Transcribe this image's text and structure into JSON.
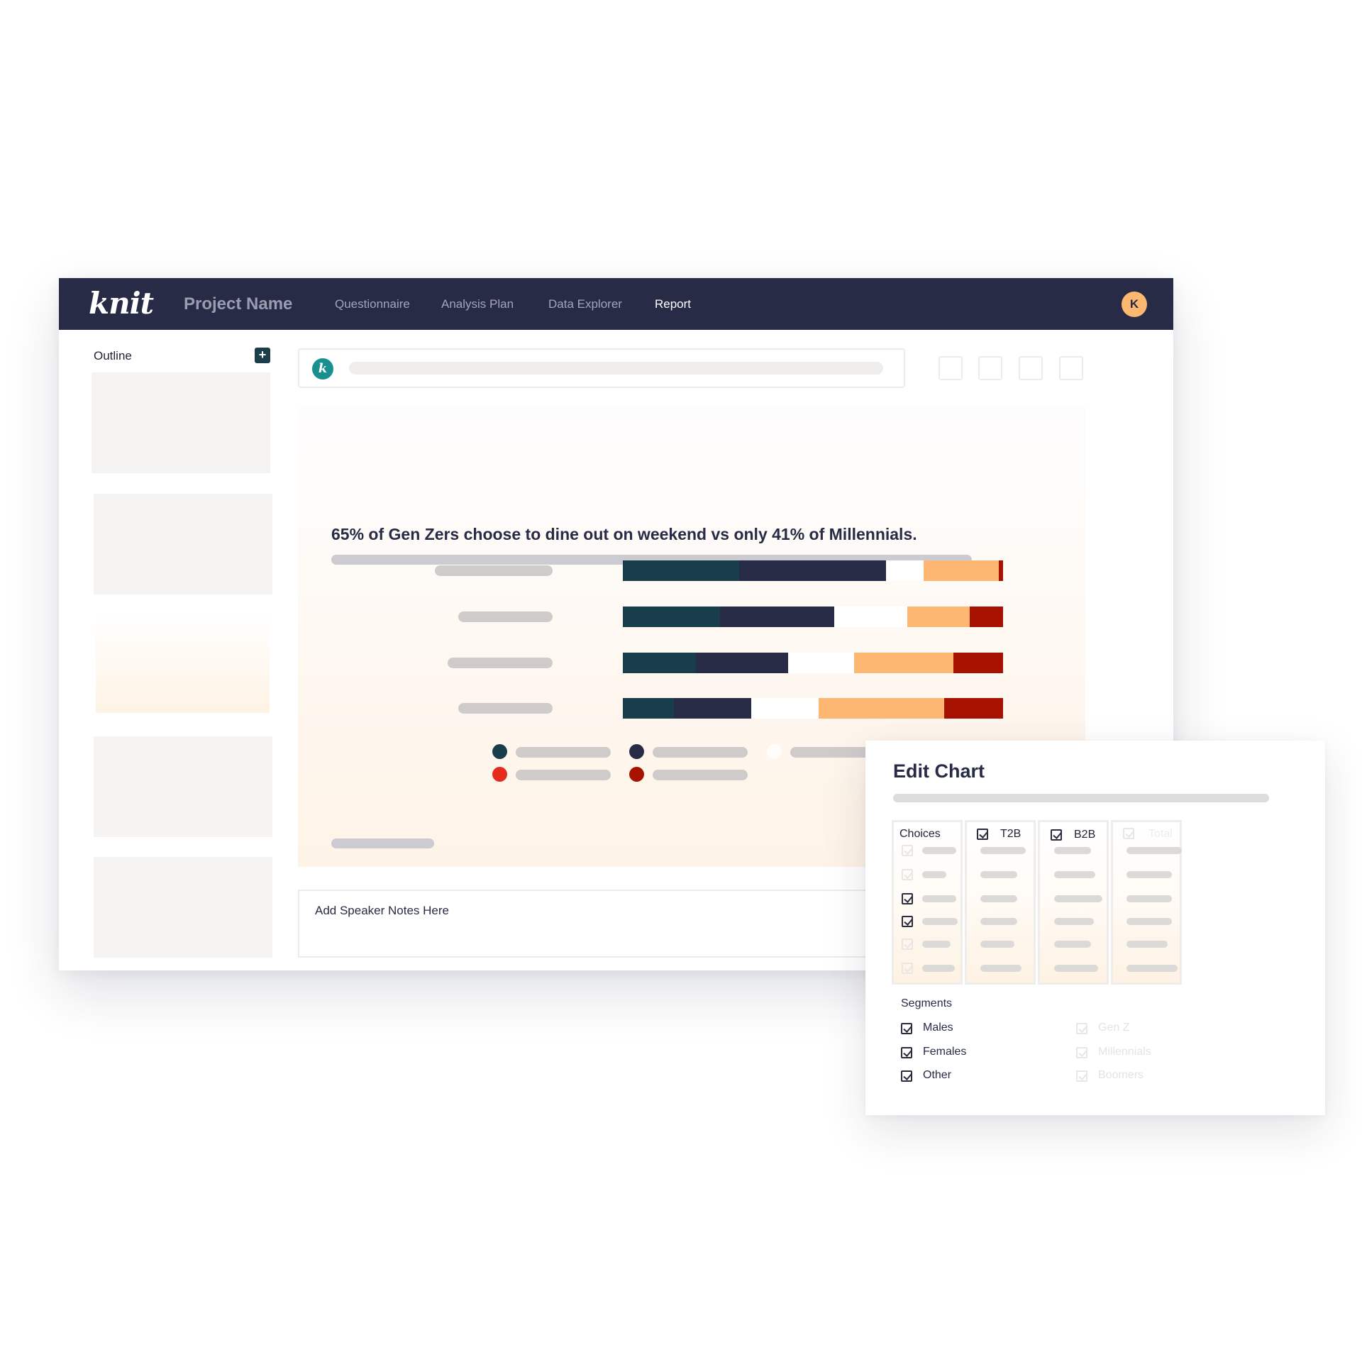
{
  "nav": {
    "logo": "knit",
    "project_name": "Project Name",
    "tabs": [
      {
        "label": "Questionnaire",
        "active": false
      },
      {
        "label": "Analysis Plan",
        "active": false
      },
      {
        "label": "Data Explorer",
        "active": false
      },
      {
        "label": "Report",
        "active": true
      }
    ],
    "avatar_initial": "K"
  },
  "sidebar": {
    "title": "Outline",
    "add_icon": "plus-icon",
    "add_glyph": "+"
  },
  "toolbar": {
    "badge_letter": "k"
  },
  "slide": {
    "headline": "65% of Gen Zers choose to dine out on weekend vs only 41% of Millennials."
  },
  "chart_data": {
    "type": "bar",
    "stacked": true,
    "orientation": "horizontal",
    "rows": [
      [
        31,
        39,
        10,
        20
      ],
      [
        28,
        33,
        21,
        18
      ],
      [
        22,
        28,
        20,
        30
      ],
      [
        16,
        24,
        21,
        39
      ]
    ],
    "series_colors": [
      "#193e4b",
      "#272b45",
      "#ffffff",
      "#fdb772",
      "#a71100"
    ],
    "legend_colors": [
      "#193e4b",
      "#272b45",
      "#fffdfa",
      "#e42b1c",
      "#a71100"
    ]
  },
  "speaker_notes": {
    "placeholder": "Add Speaker Notes Here"
  },
  "edit_chart": {
    "title": "Edit Chart",
    "columns": [
      {
        "label": "Choices",
        "checked": null
      },
      {
        "label": "T2B",
        "checked": true
      },
      {
        "label": "B2B",
        "checked": true
      },
      {
        "label": "Total",
        "checked": false
      }
    ],
    "choice_rows_checked": [
      false,
      false,
      true,
      true,
      false,
      false
    ],
    "segments_label": "Segments",
    "segments_left": [
      {
        "label": "Males",
        "checked": true
      },
      {
        "label": "Females",
        "checked": true
      },
      {
        "label": "Other",
        "checked": true
      }
    ],
    "segments_right": [
      {
        "label": "Gen Z",
        "checked": false
      },
      {
        "label": "Millennials",
        "checked": false
      },
      {
        "label": "Boomers",
        "checked": false
      }
    ]
  }
}
